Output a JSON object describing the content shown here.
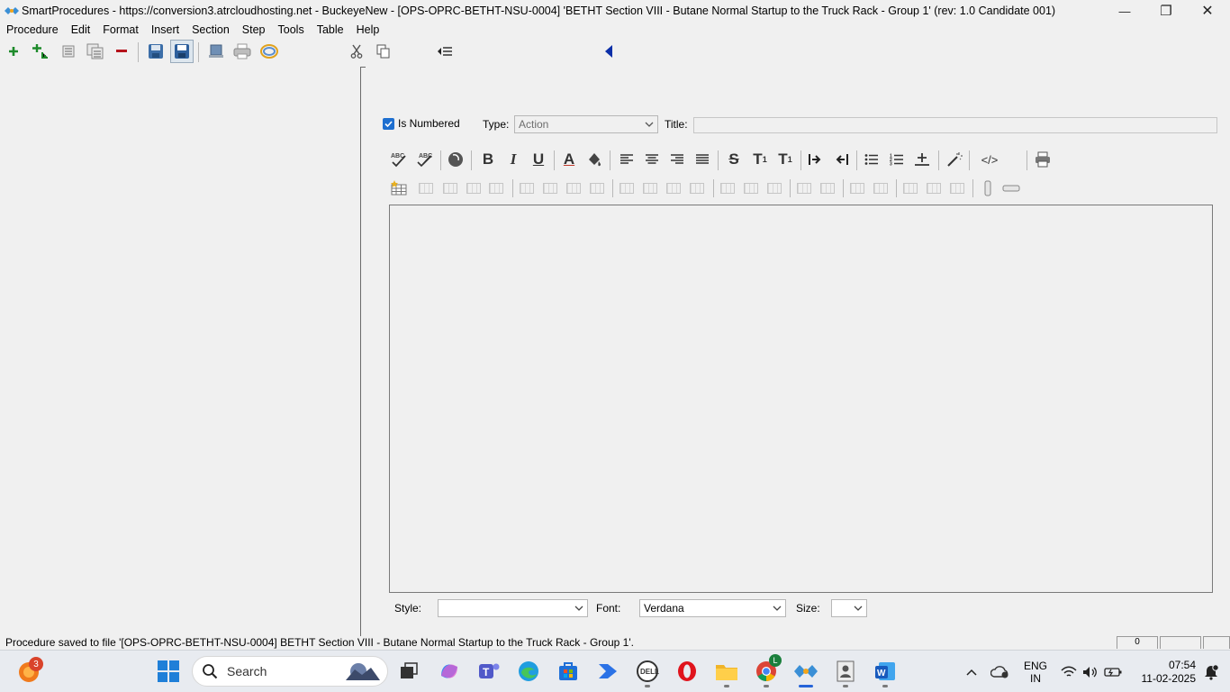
{
  "window": {
    "title": "SmartProcedures - https://conversion3.atrcloudhosting.net - BuckeyeNew - [OPS-OPRC-BETHT-NSU-0004] 'BETHT Section VIII - Butane Normal Startup to the Truck Rack - Group 1' (rev: 1.0 Candidate 001)",
    "app_icon": "smartprocedures-icon",
    "controls": {
      "minimize": "—",
      "restore": "❐",
      "close": "✕"
    }
  },
  "menu": [
    "Procedure",
    "Edit",
    "Format",
    "Insert",
    "Section",
    "Step",
    "Tools",
    "Table",
    "Help"
  ],
  "toolbar": {
    "icons": [
      "add-icon",
      "add-child-icon",
      "collapse-icon",
      "expand-icon",
      "delete-icon",
      "save-icon",
      "save-all-icon",
      "publish-icon",
      "print-icon",
      "refresh-icon",
      "cut-icon",
      "copy-icon",
      "indent-list-icon",
      "collapse-pane-icon"
    ]
  },
  "step_editor": {
    "is_numbered_label": "Is Numbered",
    "is_numbered": true,
    "type_label": "Type:",
    "type_value": "Action",
    "title_label": "Title:",
    "title_value": "",
    "format_buttons": [
      "B",
      "I",
      "U",
      "A",
      "S",
      "T",
      "T"
    ],
    "superscript_mark": "1",
    "subscript_mark": "1",
    "code_label": "</>",
    "style_label": "Style:",
    "style_value": "",
    "font_label": "Font:",
    "font_value": "Verdana",
    "size_label": "Size:",
    "size_value": ""
  },
  "status": {
    "message": "Procedure saved to file '[OPS-OPRC-BETHT-NSU-0004] BETHT Section VIII - Butane Normal Startup to the Truck Rack - Group 1'.",
    "panel_1": "0"
  },
  "taskbar": {
    "search_placeholder": "Search",
    "notification_badge": "3",
    "chrome_badge": "L",
    "language": "ENG",
    "region": "IN",
    "time": "07:54",
    "date": "11-02-2025",
    "colors": {
      "accent": "#2563d8",
      "badge": "#d9432b"
    }
  }
}
